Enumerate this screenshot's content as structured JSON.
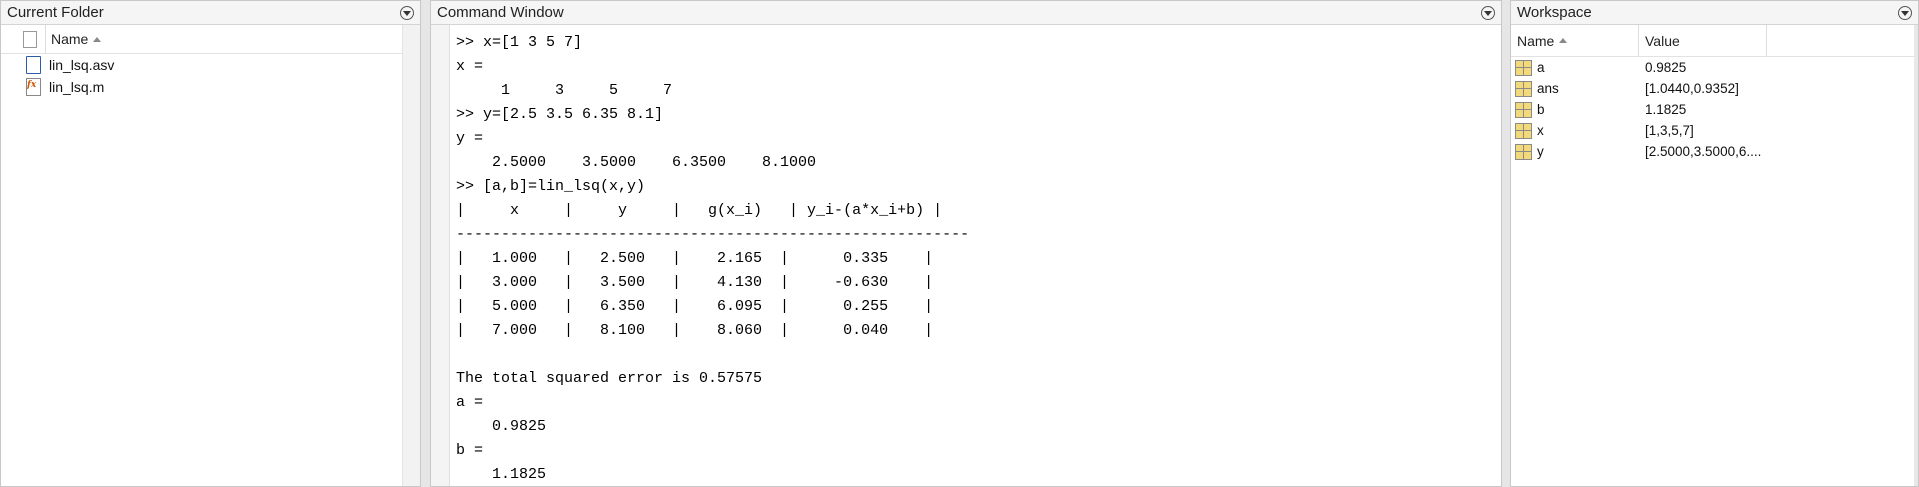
{
  "folder": {
    "title": "Current Folder",
    "column_name": "Name",
    "files": [
      {
        "name": "lin_lsq.asv",
        "icon": "document-icon"
      },
      {
        "name": "lin_lsq.m",
        "icon": "matlab-function-icon"
      }
    ]
  },
  "command": {
    "title": "Command Window",
    "lines": [
      ">> x=[1 3 5 7]",
      "x =",
      "     1     3     5     7",
      ">> y=[2.5 3.5 6.35 8.1]",
      "y =",
      "    2.5000    3.5000    6.3500    8.1000",
      ">> [a,b]=lin_lsq(x,y)",
      "|     x     |     y     |   g(x_i)   | y_i-(a*x_i+b) |",
      "---------------------------------------------------------",
      "|   1.000   |   2.500   |    2.165  |      0.335    |",
      "|   3.000   |   3.500   |    4.130  |     -0.630    |",
      "|   5.000   |   6.350   |    6.095  |      0.255    |",
      "|   7.000   |   8.100   |    8.060  |      0.040    |",
      "",
      "The total squared error is 0.57575",
      "a =",
      "    0.9825",
      "b =",
      "    1.1825"
    ]
  },
  "workspace": {
    "title": "Workspace",
    "column_name": "Name",
    "column_value": "Value",
    "vars": [
      {
        "name": "a",
        "value": "0.9825"
      },
      {
        "name": "ans",
        "value": "[1.0440,0.9352]"
      },
      {
        "name": "b",
        "value": "1.1825"
      },
      {
        "name": "x",
        "value": "[1,3,5,7]"
      },
      {
        "name": "y",
        "value": "[2.5000,3.5000,6...."
      }
    ]
  }
}
